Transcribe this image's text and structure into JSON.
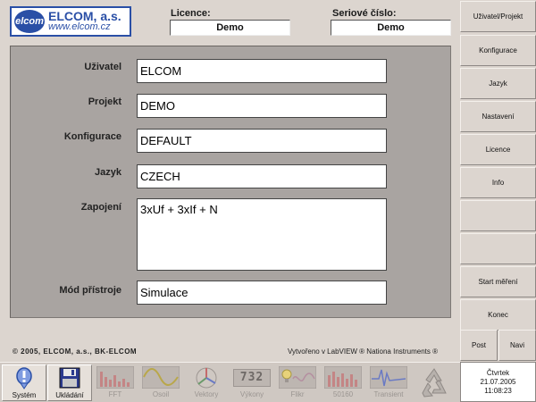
{
  "logo": {
    "mark": "elcom",
    "name": "ELCOM, a.s.",
    "url": "www.elcom.cz"
  },
  "header": {
    "licence_label": "Licence:",
    "licence_value": "Demo",
    "serial_label": "Seriové číslo:",
    "serial_value": "Demo"
  },
  "form": {
    "fields": [
      {
        "label": "Uživatel",
        "value": "ELCOM"
      },
      {
        "label": "Projekt",
        "value": "DEMO"
      },
      {
        "label": "Konfigurace",
        "value": "DEFAULT"
      },
      {
        "label": "Jazyk",
        "value": "CZECH"
      },
      {
        "label": "Zapojení",
        "value": "3xUf + 3xIf + N"
      },
      {
        "label": "Mód přístroje",
        "value": "Simulace"
      }
    ]
  },
  "footer": {
    "copyright": "© 2005, ELCOM, a.s., BK-ELCOM",
    "labview": "Vytvořeno v LabVIEW ® Nationa Instruments ®"
  },
  "sidebar": {
    "items": [
      {
        "label": "Uživatel/Projekt"
      },
      {
        "label": "Konfigurace"
      },
      {
        "label": "Jazyk"
      },
      {
        "label": "Nastavení"
      },
      {
        "label": "Licence"
      },
      {
        "label": "Info"
      },
      {
        "label": ""
      },
      {
        "label": ""
      },
      {
        "label": "Start měření"
      },
      {
        "label": "Konec"
      }
    ],
    "post": "Post",
    "navi": "Navi"
  },
  "toolbar": {
    "items": [
      {
        "label": "Systém",
        "icon": "info-bubble-icon",
        "active": true
      },
      {
        "label": "Ukládání",
        "icon": "floppy-disk-icon",
        "active": true
      },
      {
        "label": "FFT",
        "icon": "fft-bars-icon",
        "active": false
      },
      {
        "label": "Osoil",
        "icon": "sine-wave-icon",
        "active": false
      },
      {
        "label": "Vektory",
        "icon": "vector-diagram-icon",
        "active": false
      },
      {
        "label": "Výkony",
        "icon": "digit-display-icon",
        "active": false,
        "digits": "732"
      },
      {
        "label": "Flikr",
        "icon": "bulb-wave-icon",
        "active": false
      },
      {
        "label": "50160",
        "icon": "histogram-icon",
        "active": false
      },
      {
        "label": "Transient",
        "icon": "transient-icon",
        "active": false
      },
      {
        "label": "",
        "icon": "recycle-icon",
        "active": false
      }
    ]
  },
  "clock": {
    "day": "Čtvrtek",
    "date": "21.07.2005",
    "time": "11:08:23"
  },
  "colors": {
    "accent": "#2a4fa6",
    "panel": "#a9a4a1",
    "background": "#dcd5cf"
  }
}
